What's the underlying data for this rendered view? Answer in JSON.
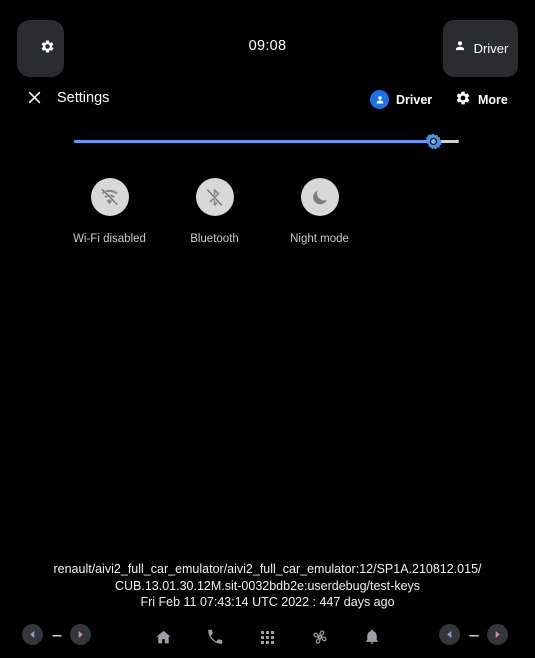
{
  "system_bar": {
    "settings_icon": "gear-icon",
    "clock": "09:08",
    "user_icon": "person-icon",
    "user_label": "Driver"
  },
  "panel": {
    "close_icon": "close-icon",
    "title": "Settings",
    "actions": [
      {
        "label": "Driver",
        "icon": "user-avatar-icon"
      },
      {
        "label": "More",
        "icon": "gear-icon"
      }
    ]
  },
  "brightness": {
    "name": "brightness-slider",
    "thumb_icon": "brightness-gear-icon",
    "value_percent": 93,
    "track_color": "#d6cfc4",
    "fill_color": "#5e97f6"
  },
  "quick_tiles": [
    {
      "label": "Wi-Fi disabled",
      "icon": "wifi-off-icon"
    },
    {
      "label": "Bluetooth",
      "icon": "bluetooth-icon"
    },
    {
      "label": "Night mode",
      "icon": "moon-icon"
    }
  ],
  "build_info": {
    "line1": "renault/aivi2_full_car_emulator/aivi2_full_car_emulator:12/SP1A.210812.015/",
    "line2": "CUB.13.01.30.12M.sit-0032bdb2e:userdebug/test-keys",
    "line3": "Fri Feb 11 07:43:14 UTC 2022 : 447 days ago"
  },
  "nav_bar": {
    "left_cluster": {
      "back_icon": "triangle-left-icon",
      "separator": "---",
      "forward_icon": "triangle-right-icon"
    },
    "center_icons": [
      {
        "name": "home-icon"
      },
      {
        "name": "phone-icon"
      },
      {
        "name": "apps-grid-icon"
      },
      {
        "name": "climate-fan-icon"
      },
      {
        "name": "notifications-bell-icon"
      }
    ],
    "right_cluster": {
      "back_icon": "triangle-left-icon",
      "separator": "---",
      "forward_icon": "triangle-right-icon"
    }
  }
}
